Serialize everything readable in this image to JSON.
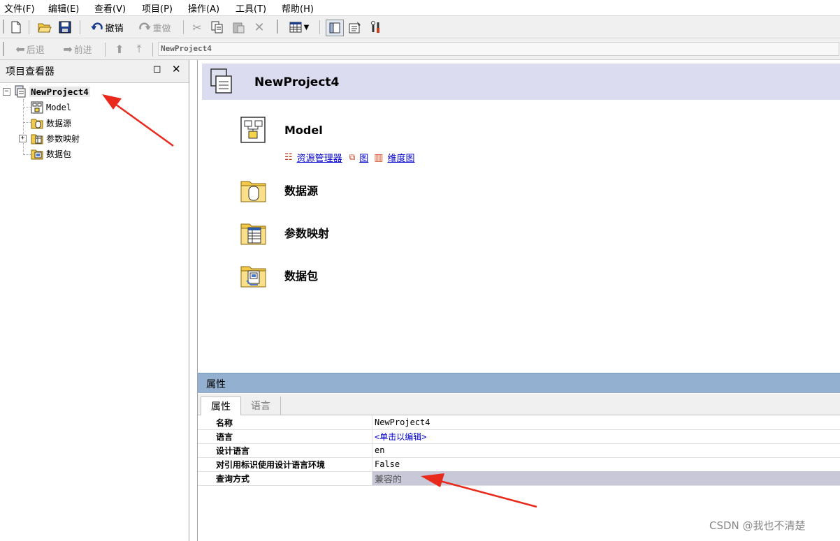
{
  "menu": [
    "文件(F)",
    "编辑(E)",
    "查看(V)",
    "项目(P)",
    "操作(A)",
    "工具(T)",
    "帮助(H)"
  ],
  "toolbar": {
    "undo_label": "撤销",
    "redo_label": "重做"
  },
  "nav": {
    "back_label": "后退",
    "forward_label": "前进",
    "path": "NewProject4"
  },
  "explorer": {
    "title": "项目查看器",
    "root": "NewProject4",
    "items": [
      "Model",
      "数据源",
      "参数映射",
      "数据包"
    ]
  },
  "main": {
    "project_title": "NewProject4",
    "model": {
      "title": "Model",
      "links": [
        "资源管理器",
        "图",
        "维度图"
      ]
    },
    "sections": [
      "数据源",
      "参数映射",
      "数据包"
    ]
  },
  "properties": {
    "title": "属性",
    "tabs": [
      "属性",
      "语言"
    ],
    "rows": [
      {
        "name": "名称",
        "value": "NewProject4"
      },
      {
        "name": "语言",
        "value": "<单击以编辑>"
      },
      {
        "name": "设计语言",
        "value": "en"
      },
      {
        "name": "对引用标识使用设计语言环境",
        "value": "False"
      },
      {
        "name": "查询方式",
        "value": "兼容的"
      }
    ]
  },
  "watermark": "CSDN @我也不清楚",
  "colors": {
    "header_bg": "#dcdcf0",
    "props_bar": "#94b0d0",
    "selected_row": "#c8c8d8",
    "arrow": "#e8291c"
  }
}
